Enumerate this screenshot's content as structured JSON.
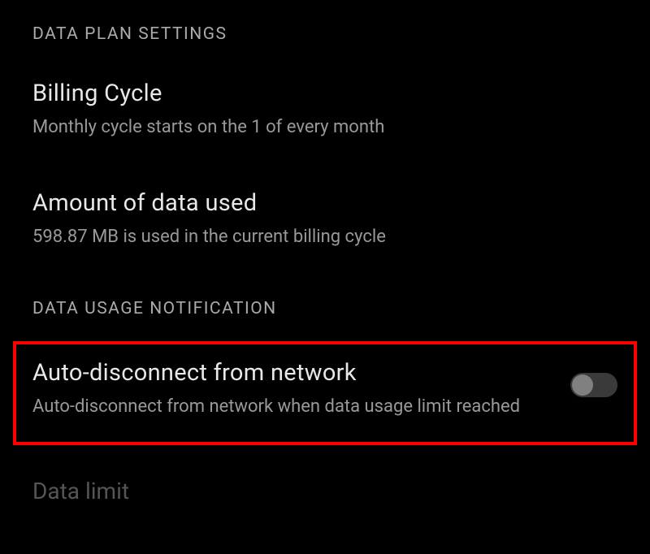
{
  "sections": {
    "dataPlan": {
      "header": "DATA PLAN SETTINGS",
      "billingCycle": {
        "title": "Billing Cycle",
        "subtitle": "Monthly cycle starts on the 1 of every month"
      },
      "dataUsed": {
        "title": "Amount of data used",
        "subtitle": "598.87 MB is used in the current billing cycle"
      }
    },
    "dataUsageNotification": {
      "header": "DATA USAGE NOTIFICATION",
      "autoDisconnect": {
        "title": "Auto-disconnect from network",
        "subtitle": "Auto-disconnect from network when data usage limit reached",
        "toggleState": false
      },
      "dataLimit": {
        "title": "Data limit"
      }
    }
  }
}
